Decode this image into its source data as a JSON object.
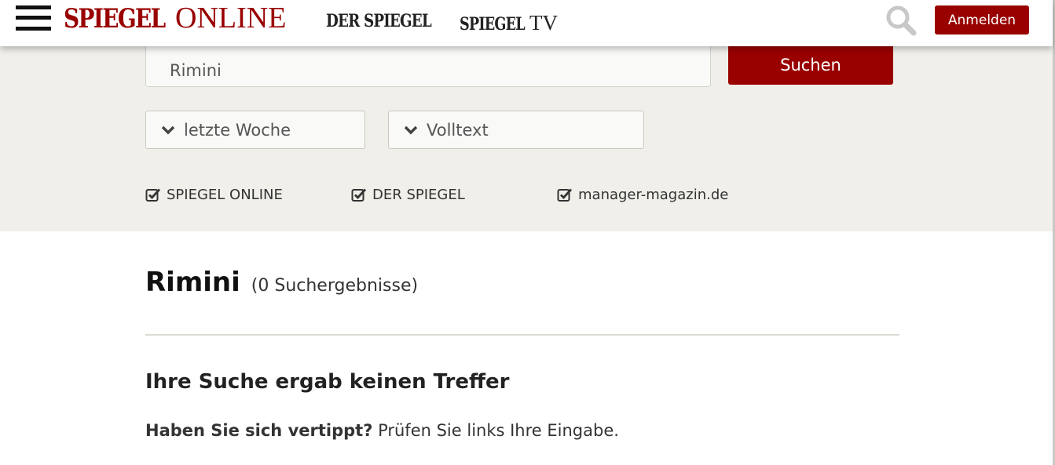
{
  "header": {
    "logo_part1": "SPIEGEL",
    "logo_part2": "ONLINE",
    "nav_der_spiegel": "DER SPIEGEL",
    "nav_spiegel_tv_part1": "SPIEGEL",
    "nav_spiegel_tv_part2": "TV",
    "login_label": "Anmelden",
    "menu_icon": "hamburger-menu-icon",
    "search_icon": "magnifier-icon"
  },
  "search": {
    "query_value": "Rimini",
    "submit_label": "Suchen",
    "time_filter": "letzte Woche",
    "type_filter": "Volltext",
    "sources": [
      {
        "label": "SPIEGEL ONLINE",
        "checked": true
      },
      {
        "label": "DER SPIEGEL",
        "checked": true
      },
      {
        "label": "manager-magazin.de",
        "checked": true
      }
    ]
  },
  "results": {
    "query": "Rimini",
    "count_text": "(0 Suchergebnisse)",
    "no_results_heading": "Ihre Suche ergab keinen Treffer",
    "hint_strong": "Haben Sie sich vertippt?",
    "hint_text": " Prüfen Sie links Ihre Eingabe."
  },
  "colors": {
    "brand_red": "#990000",
    "panel_bg": "#f0efea",
    "icon_gray": "#c8c8c8"
  }
}
